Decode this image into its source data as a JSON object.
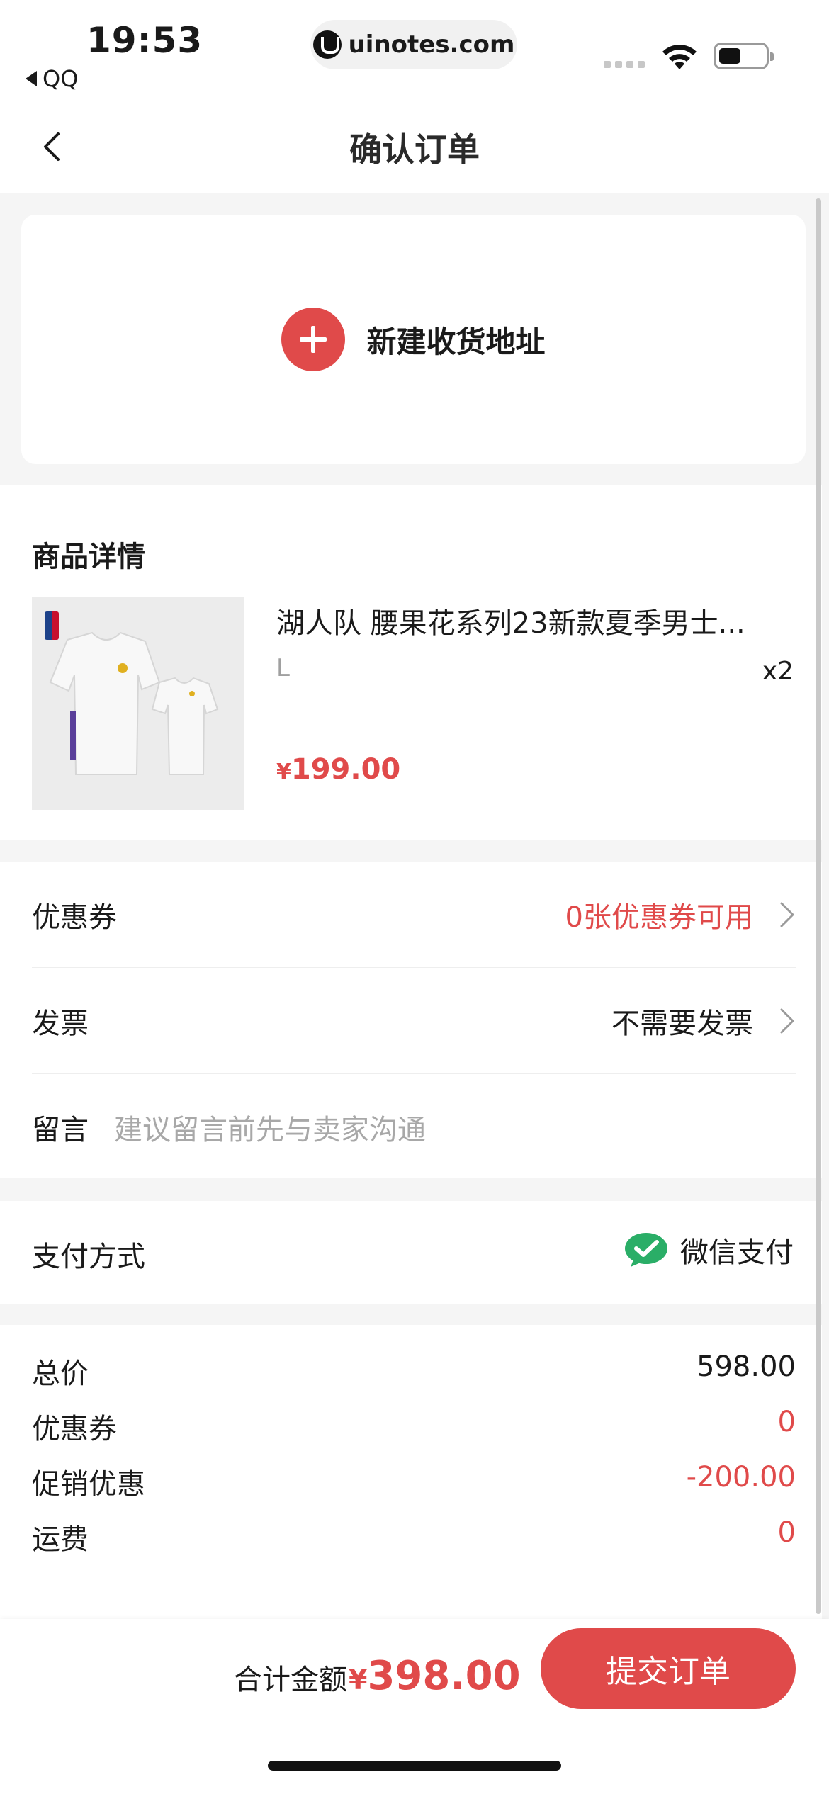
{
  "status_bar": {
    "time": "19:53",
    "back_app": "QQ",
    "url": "uinotes.com"
  },
  "nav": {
    "title": "确认订单"
  },
  "address": {
    "add_label": "新建收货地址"
  },
  "product": {
    "section_title": "商品详情",
    "name": "湖人队  腰果花系列23新款夏季男士...",
    "spec": "L",
    "quantity": "x2",
    "currency": "¥",
    "price": "199.00"
  },
  "options": {
    "coupon_label": "优惠券",
    "coupon_value": "0张优惠券可用",
    "invoice_label": "发票",
    "invoice_value": "不需要发票",
    "note_label": "留言",
    "note_placeholder": "建议留言前先与卖家沟通"
  },
  "payment": {
    "label": "支付方式",
    "method": "微信支付"
  },
  "totals": {
    "total_label": "总价",
    "total_value": "598.00",
    "coupon_label": "优惠券",
    "coupon_value": "0",
    "promo_label": "促销优惠",
    "promo_value": "-200.00",
    "shipping_label": "运费",
    "shipping_value": "0"
  },
  "bottom": {
    "sum_label": "合计金额",
    "currency": "¥",
    "sum_amount": "398.00",
    "submit_label": "提交订单"
  },
  "colors": {
    "accent": "#e04a4a",
    "wechat_green": "#2aae67",
    "background": "#f5f5f5"
  },
  "icons": {
    "nav_back": "chevron-left-icon",
    "add": "plus-circle-icon",
    "row_arrow": "chevron-right-icon",
    "wechat": "wechat-pay-icon"
  }
}
